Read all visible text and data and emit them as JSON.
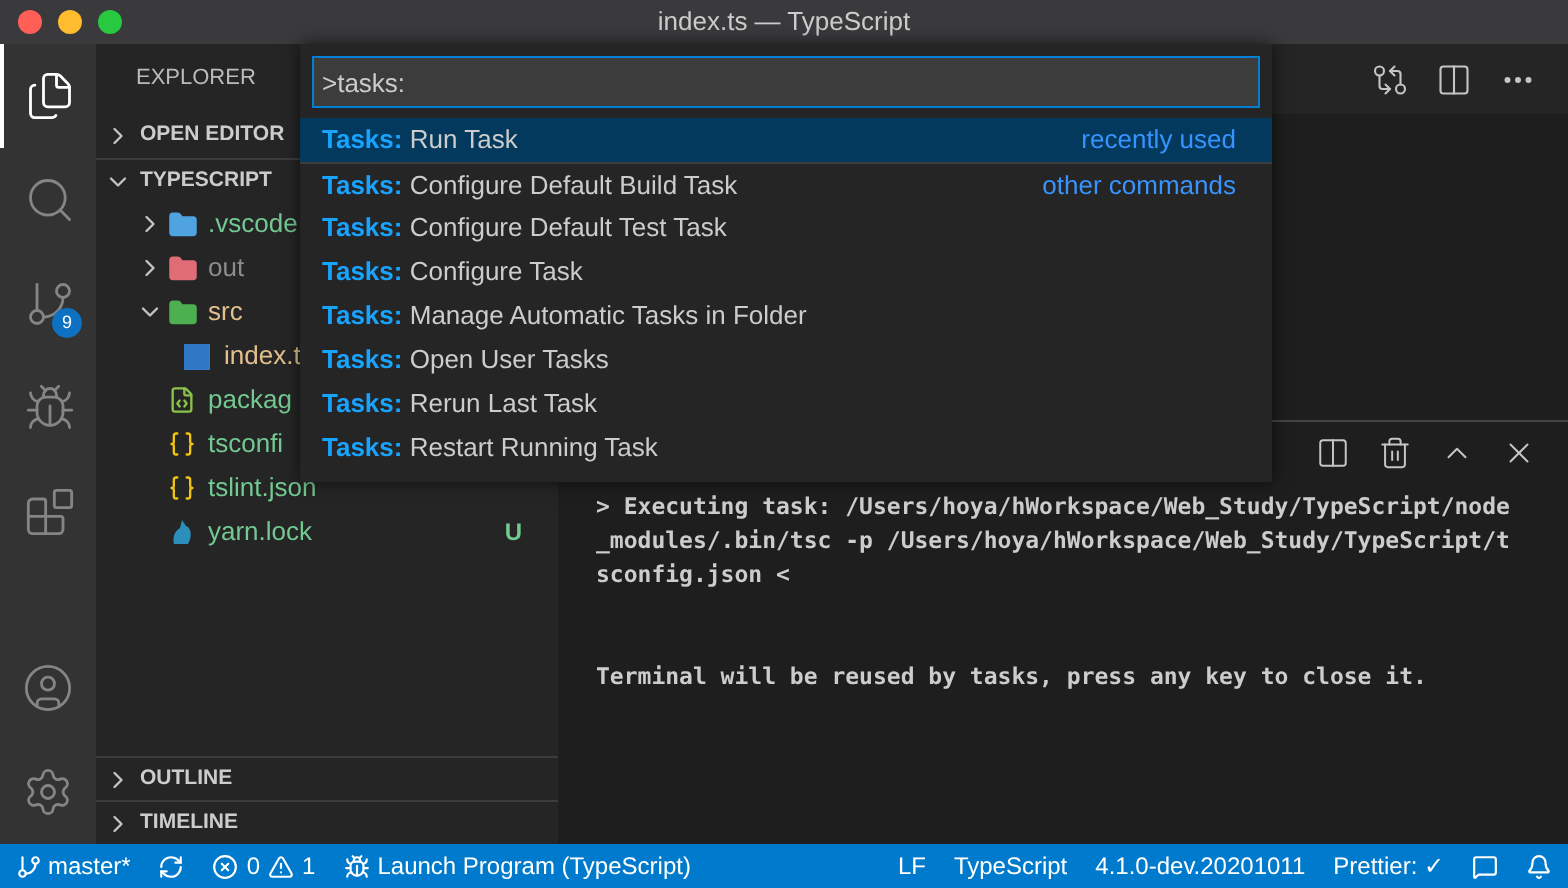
{
  "window": {
    "title": "index.ts — TypeScript"
  },
  "activity_bar": {
    "items": [
      {
        "kind": "explorer",
        "selected": true
      },
      {
        "kind": "search",
        "selected": false
      },
      {
        "kind": "source-control",
        "selected": false,
        "badge": "9"
      },
      {
        "kind": "run",
        "selected": false
      },
      {
        "kind": "extensions",
        "selected": false
      }
    ],
    "bottom": [
      {
        "kind": "account"
      },
      {
        "kind": "settings"
      }
    ]
  },
  "sidebar": {
    "title": "EXPLORER",
    "sections": [
      {
        "label": "OPEN EDITOR",
        "expanded": false
      },
      {
        "label": "TYPESCRIPT",
        "expanded": true
      }
    ],
    "tree": [
      {
        "name": ".vscode",
        "kind": "vscode-folder",
        "expanded": false,
        "color": "#73c991"
      },
      {
        "name": "out",
        "kind": "out-folder",
        "expanded": false,
        "color": "#8c8c8c"
      },
      {
        "name": "src",
        "kind": "src-folder",
        "expanded": true,
        "color": "#e2c08d",
        "children": [
          {
            "name": "index.t",
            "kind": "ts-file",
            "color": "#e2c08d"
          }
        ]
      },
      {
        "name": "packag",
        "kind": "node-file",
        "color": "#73c991"
      },
      {
        "name": "tsconfi",
        "kind": "json-file",
        "color": "#73c991"
      },
      {
        "name": "tslint.json",
        "kind": "json-file",
        "color": "#73c991"
      },
      {
        "name": "yarn.lock",
        "kind": "yarn-file",
        "color": "#73c991",
        "badge": "U"
      }
    ],
    "bottom_sections": [
      {
        "label": "OUTLINE",
        "expanded": false
      },
      {
        "label": "TIMELINE",
        "expanded": false
      }
    ]
  },
  "command_palette": {
    "value": ">tasks:",
    "items": [
      {
        "prefix": "Tasks:",
        "label": "Run Task",
        "selected": true,
        "hint": "recently used"
      },
      {
        "prefix": "Tasks:",
        "label": "Configure Default Build Task",
        "selected": false,
        "hint": "other commands"
      },
      {
        "prefix": "Tasks:",
        "label": "Configure Default Test Task",
        "selected": false
      },
      {
        "prefix": "Tasks:",
        "label": "Configure Task",
        "selected": false
      },
      {
        "prefix": "Tasks:",
        "label": "Manage Automatic Tasks in Folder",
        "selected": false
      },
      {
        "prefix": "Tasks:",
        "label": "Open User Tasks",
        "selected": false
      },
      {
        "prefix": "Tasks:",
        "label": "Rerun Last Task",
        "selected": false
      },
      {
        "prefix": "Tasks:",
        "label": "Restart Running Task",
        "selected": false
      }
    ]
  },
  "terminal": {
    "paragraphs": [
      {
        "lines": [
          "> Executing task: /Users/hoya/hWorkspace/Web_Study/TypeScript/node",
          "_modules/.bin/tsc -p /Users/hoya/hWorkspace/Web_Study/TypeScript/t",
          "sconfig.json <"
        ]
      },
      {
        "lines": [
          "Terminal will be reused by tasks, press any key to close it."
        ]
      }
    ]
  },
  "status_bar": {
    "left": [
      {
        "kind": "branch",
        "text": "master*"
      },
      {
        "kind": "sync"
      },
      {
        "kind": "problems",
        "errors": "0",
        "warnings": "1"
      },
      {
        "kind": "launch",
        "text": "Launch Program (TypeScript)"
      }
    ],
    "right": [
      "LF",
      "TypeScript",
      "4.1.0-dev.20201011",
      "Prettier: ✓"
    ]
  }
}
